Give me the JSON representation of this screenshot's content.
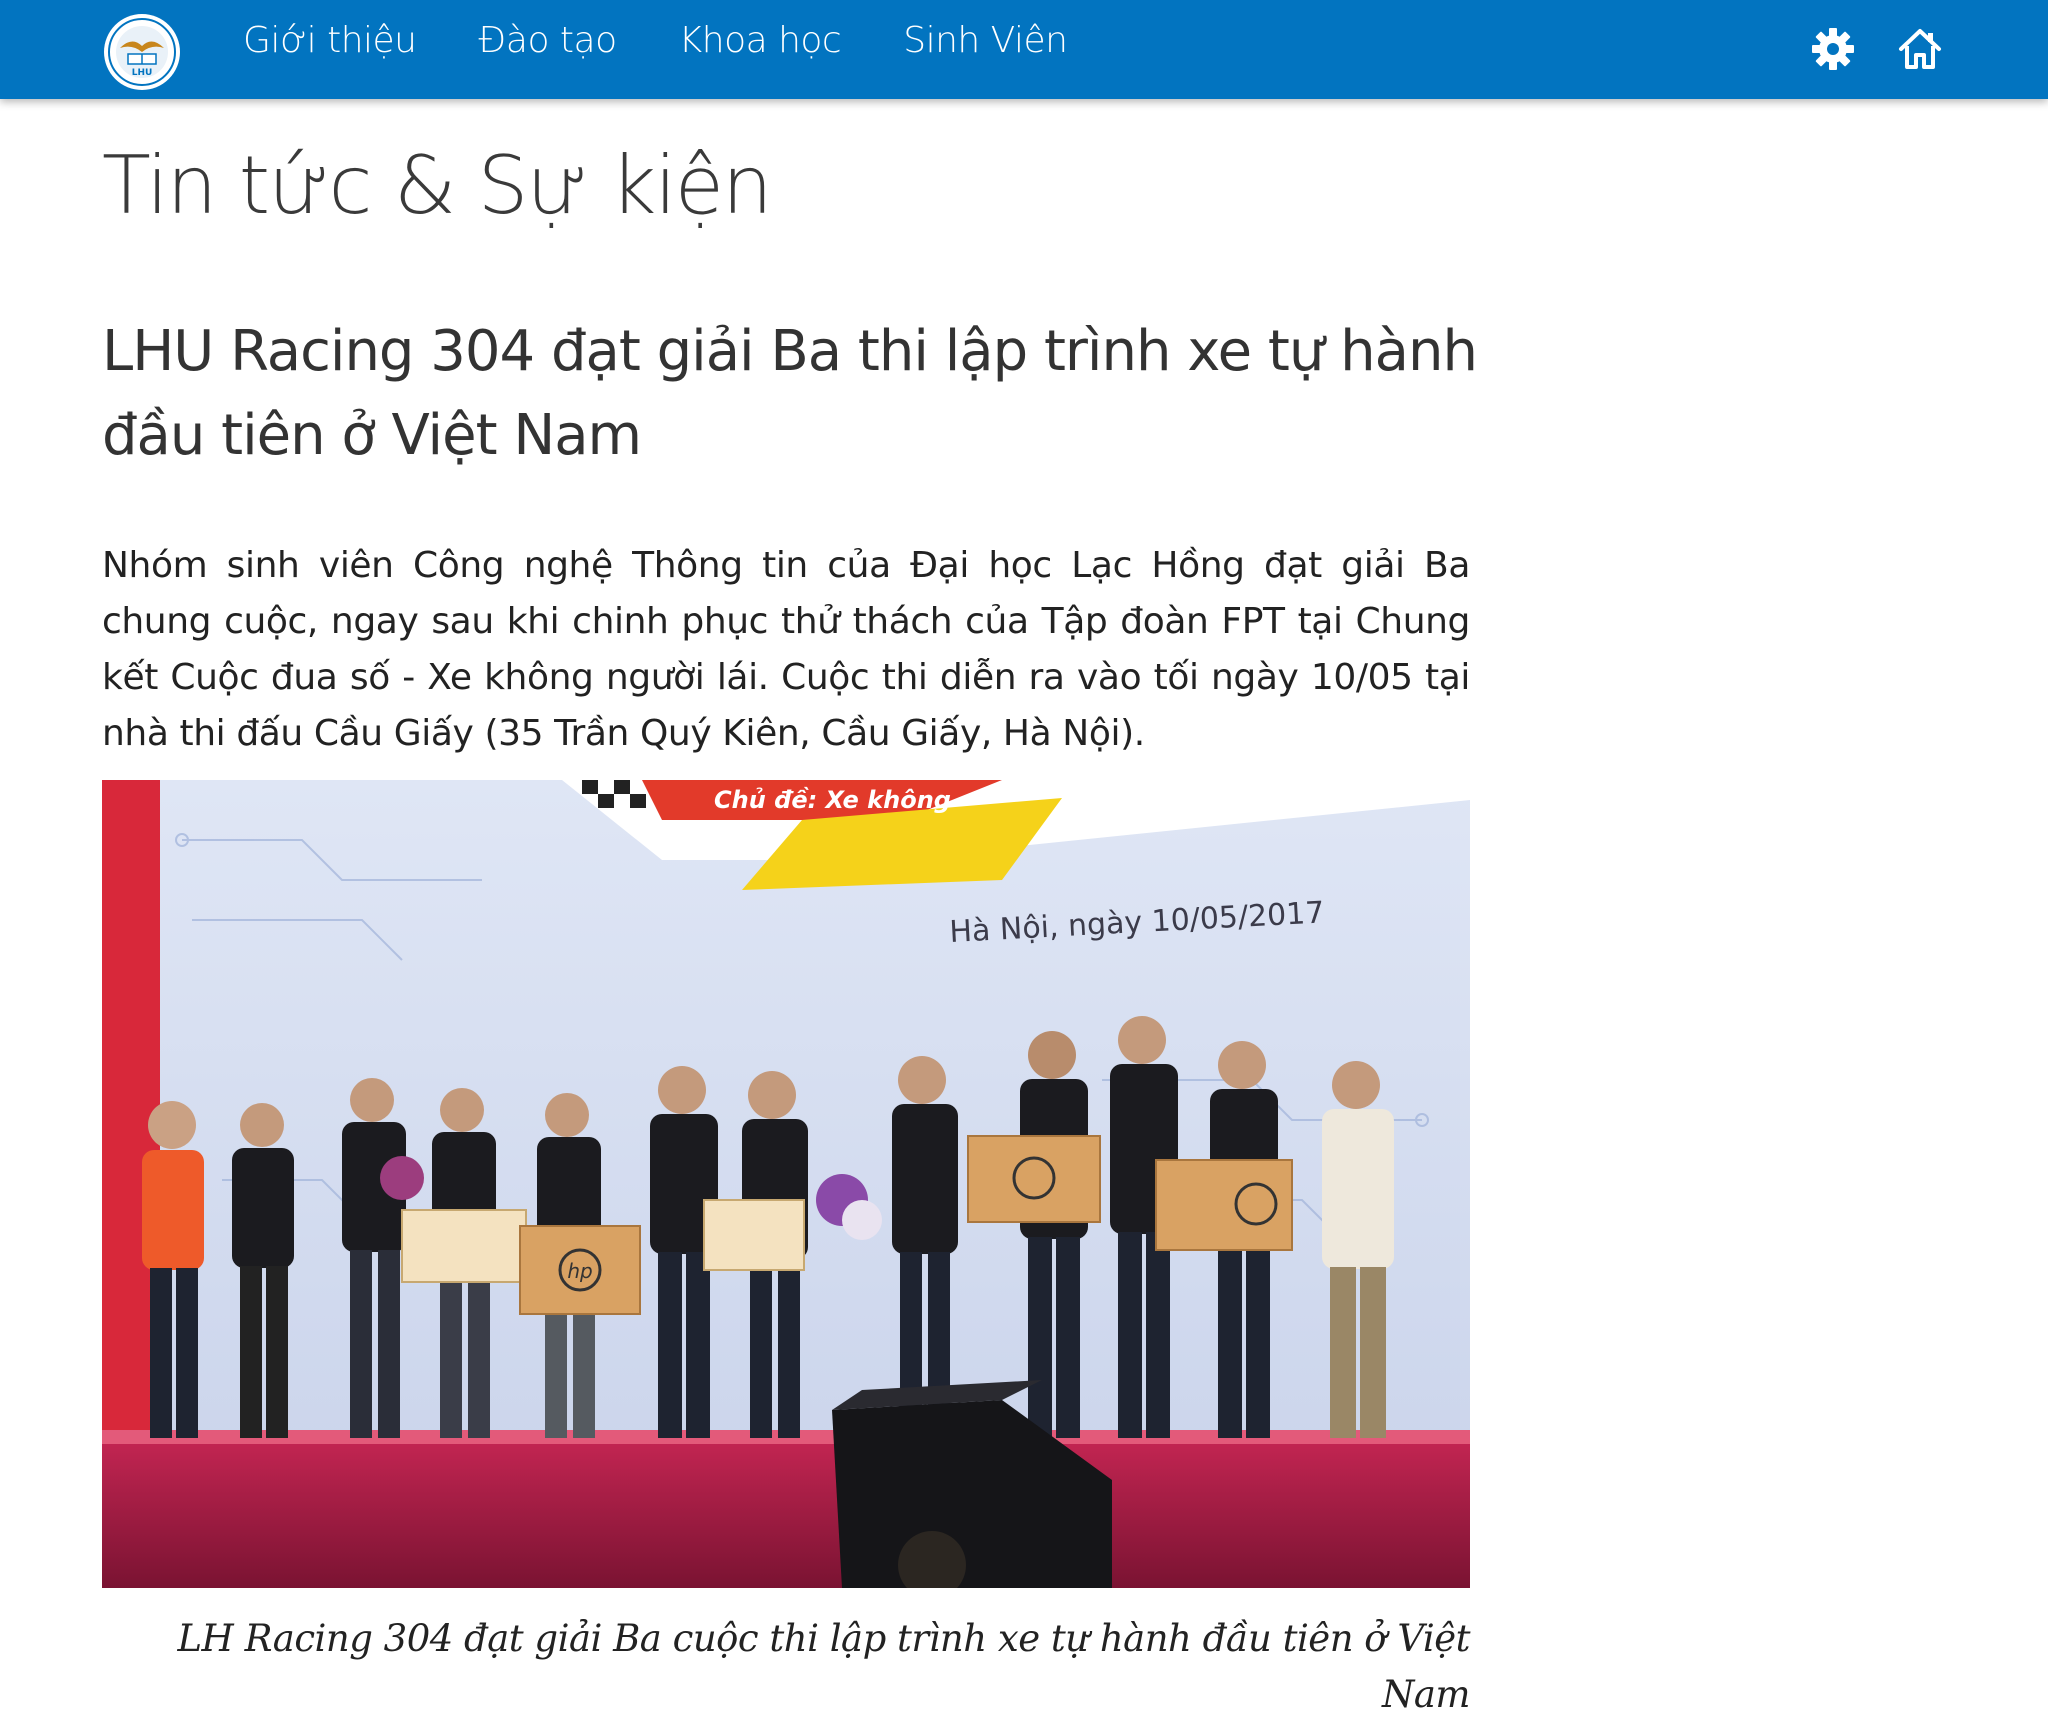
{
  "nav": {
    "items": [
      {
        "label": "Giới thiệu"
      },
      {
        "label": "Đào tạo"
      },
      {
        "label": "Khoa học"
      },
      {
        "label": "Sinh Viên"
      }
    ],
    "icons": [
      "gear-icon",
      "home-icon"
    ],
    "logo_text": "LHU"
  },
  "colors": {
    "navbar": "#0274c0",
    "nav_text": "#ffffff",
    "body_text": "#333333"
  },
  "page": {
    "title": "Tin tức & Sự kiện"
  },
  "article": {
    "title": "LHU Racing 304 đạt giải Ba thi lập trình xe tự hành đầu tiên ở Việt Nam",
    "lead": "Nhóm sinh viên Công nghệ Thông tin của Đại học Lạc Hồng đạt giải Ba chung cuộc, ngay sau khi chinh phục thử thách của Tập đoàn FPT tại Chung kết Cuộc đua số - Xe không người lái. Cuộc thi diễn ra vào tối ngày 10/05 tại nhà thi đấu Cầu Giấy (35 Trần Quý Kiên, Cầu Giấy, Hà Nội).",
    "photo": {
      "backdrop_text": "Hà Nội, ngày 10/05/2017",
      "banner_text": "Chủ đề: Xe không",
      "box_brand": "hp"
    },
    "caption": "LH Racing 304 đạt giải Ba cuộc thi lập trình xe tự hành đầu tiên ở Việt Nam"
  }
}
